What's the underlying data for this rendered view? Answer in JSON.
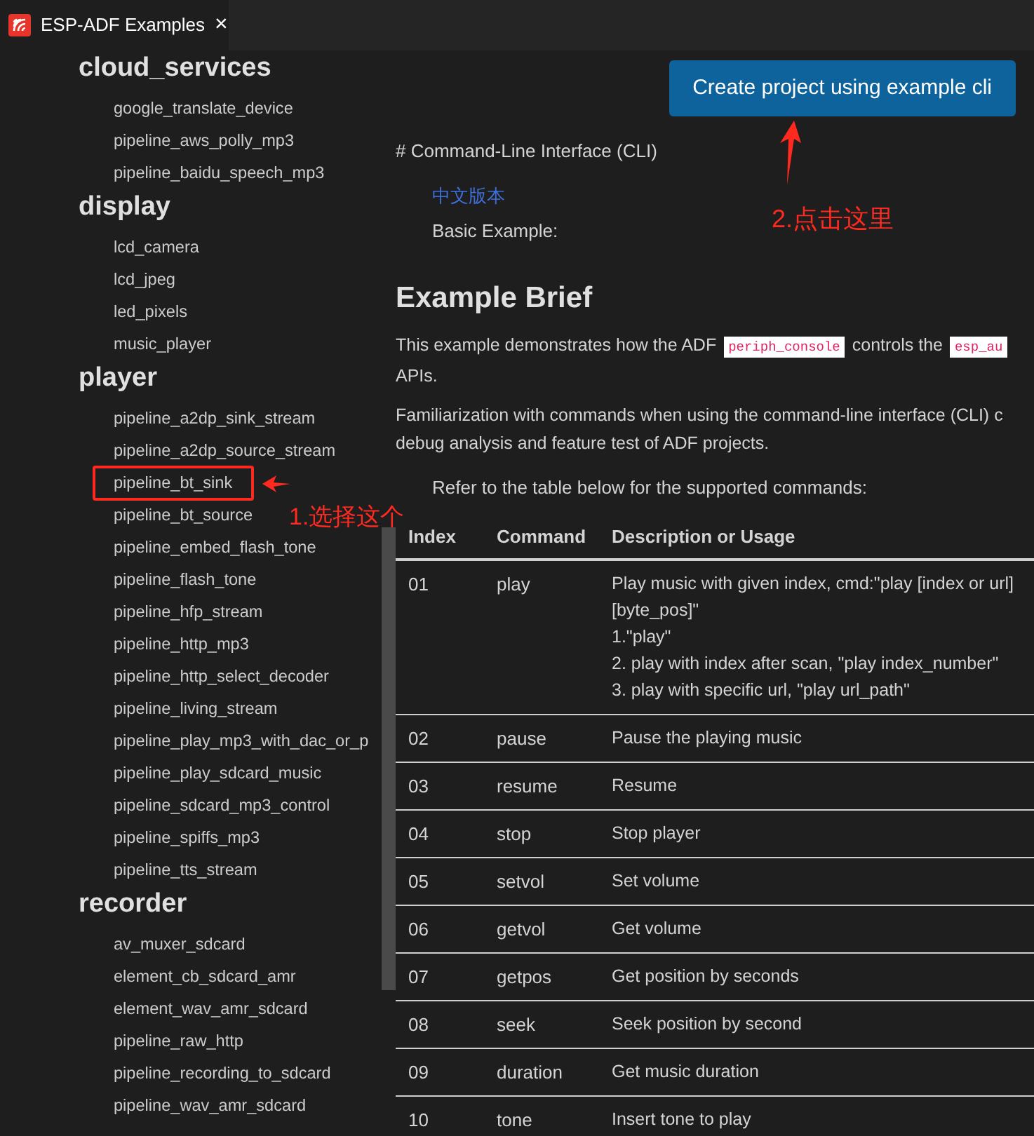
{
  "tab": {
    "title": "ESP-ADF Examples",
    "close": "×"
  },
  "sidebar": {
    "groups": [
      {
        "heading": "cloud_services",
        "items": [
          {
            "label": "google_translate_device",
            "highlighted": false
          },
          {
            "label": "pipeline_aws_polly_mp3",
            "highlighted": false
          },
          {
            "label": "pipeline_baidu_speech_mp3",
            "highlighted": false
          }
        ]
      },
      {
        "heading": "display",
        "items": [
          {
            "label": "lcd_camera",
            "highlighted": false
          },
          {
            "label": "lcd_jpeg",
            "highlighted": false
          },
          {
            "label": "led_pixels",
            "highlighted": false
          },
          {
            "label": "music_player",
            "highlighted": false
          }
        ]
      },
      {
        "heading": "player",
        "items": [
          {
            "label": "pipeline_a2dp_sink_stream",
            "highlighted": false
          },
          {
            "label": "pipeline_a2dp_source_stream",
            "highlighted": false
          },
          {
            "label": "pipeline_bt_sink",
            "highlighted": true
          },
          {
            "label": "pipeline_bt_source",
            "highlighted": false
          },
          {
            "label": "pipeline_embed_flash_tone",
            "highlighted": false
          },
          {
            "label": "pipeline_flash_tone",
            "highlighted": false
          },
          {
            "label": "pipeline_hfp_stream",
            "highlighted": false
          },
          {
            "label": "pipeline_http_mp3",
            "highlighted": false
          },
          {
            "label": "pipeline_http_select_decoder",
            "highlighted": false
          },
          {
            "label": "pipeline_living_stream",
            "highlighted": false
          },
          {
            "label": "pipeline_play_mp3_with_dac_or_p",
            "highlighted": false
          },
          {
            "label": "pipeline_play_sdcard_music",
            "highlighted": false
          },
          {
            "label": "pipeline_sdcard_mp3_control",
            "highlighted": false
          },
          {
            "label": "pipeline_spiffs_mp3",
            "highlighted": false
          },
          {
            "label": "pipeline_tts_stream",
            "highlighted": false
          }
        ]
      },
      {
        "heading": "recorder",
        "items": [
          {
            "label": "av_muxer_sdcard",
            "highlighted": false
          },
          {
            "label": "element_cb_sdcard_amr",
            "highlighted": false
          },
          {
            "label": "element_wav_amr_sdcard",
            "highlighted": false
          },
          {
            "label": "pipeline_raw_http",
            "highlighted": false
          },
          {
            "label": "pipeline_recording_to_sdcard",
            "highlighted": false
          },
          {
            "label": "pipeline_wav_amr_sdcard",
            "highlighted": false
          }
        ]
      }
    ]
  },
  "content": {
    "button": "Create project using example cli",
    "title_line": "# Command-Line Interface (CLI)",
    "link": "中文版本",
    "subtitle": "Basic Example:",
    "heading": "Example Brief",
    "paragraphs": [
      {
        "lines": [
          [
            {
              "kind": "text",
              "text": "This example demonstrates how the ADF "
            },
            {
              "kind": "code",
              "text": "periph_console"
            },
            {
              "kind": "text",
              "text": " controls the "
            },
            {
              "kind": "code",
              "text": "esp_au"
            }
          ],
          [
            {
              "kind": "text",
              "text": "APIs."
            }
          ]
        ]
      },
      {
        "lines": [
          [
            {
              "kind": "text",
              "text": "Familiarization with commands when using the command-line interface (CLI) c"
            }
          ],
          [
            {
              "kind": "text",
              "text": "debug analysis and feature test of ADF projects."
            }
          ]
        ]
      }
    ],
    "table_intro": "Refer to the table below for the supported commands:",
    "table": {
      "columns": [
        "Index",
        "Command",
        "Description or Usage"
      ],
      "rows": [
        {
          "index": "01",
          "command": "play",
          "description": [
            "Play music with given index, cmd:\"play [index or url]",
            "[byte_pos]\"",
            "1.\"play\"",
            "2. play with index after scan, \"play index_number\"",
            "3. play with specific url, \"play url_path\""
          ]
        },
        {
          "index": "02",
          "command": "pause",
          "description": [
            "Pause the playing music"
          ]
        },
        {
          "index": "03",
          "command": "resume",
          "description": [
            "Resume"
          ]
        },
        {
          "index": "04",
          "command": "stop",
          "description": [
            "Stop player"
          ]
        },
        {
          "index": "05",
          "command": "setvol",
          "description": [
            "Set volume"
          ]
        },
        {
          "index": "06",
          "command": "getvol",
          "description": [
            "Get volume"
          ]
        },
        {
          "index": "07",
          "command": "getpos",
          "description": [
            "Get position by seconds"
          ]
        },
        {
          "index": "08",
          "command": "seek",
          "description": [
            "Seek position by second"
          ]
        },
        {
          "index": "09",
          "command": "duration",
          "description": [
            "Get music duration"
          ]
        },
        {
          "index": "10",
          "command": "tone",
          "description": [
            "Insert tone to play"
          ]
        }
      ]
    }
  },
  "annotations": [
    {
      "kind": "select",
      "text": "1.选择这个"
    },
    {
      "kind": "click",
      "text": "2.点击这里"
    }
  ]
}
